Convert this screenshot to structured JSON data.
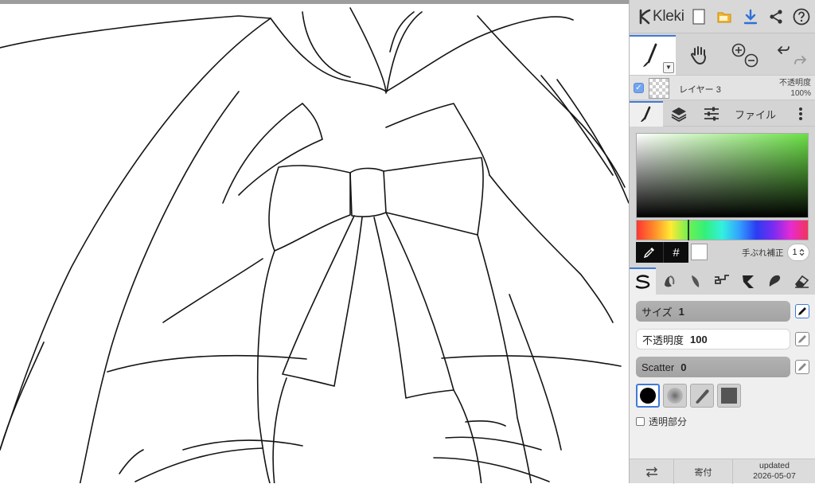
{
  "app": {
    "name": "Kleki"
  },
  "layer": {
    "name": "レイヤー 3",
    "opacity_label": "不透明度",
    "opacity_value": "100%",
    "visible": true
  },
  "tabs": {
    "file_label": "ファイル"
  },
  "color": {
    "hex_button": "#",
    "stabilizer_label": "手ぶれ補正",
    "stabilizer_value": "1",
    "hue_accent": "#6be046",
    "primary": "#000000",
    "secondary": "#ffffff"
  },
  "brush": {
    "size_label": "サイズ",
    "size_value": "1",
    "opacity_label": "不透明度",
    "opacity_value": "100",
    "scatter_label": "Scatter",
    "scatter_value": "0",
    "transparent_label": "透明部分"
  },
  "footer": {
    "donate_label": "寄付",
    "updated_label": "updated",
    "updated_date": "2026-05-07"
  },
  "colors": {
    "accent": "#3f7ad8",
    "panel": "#d4d4d4"
  }
}
